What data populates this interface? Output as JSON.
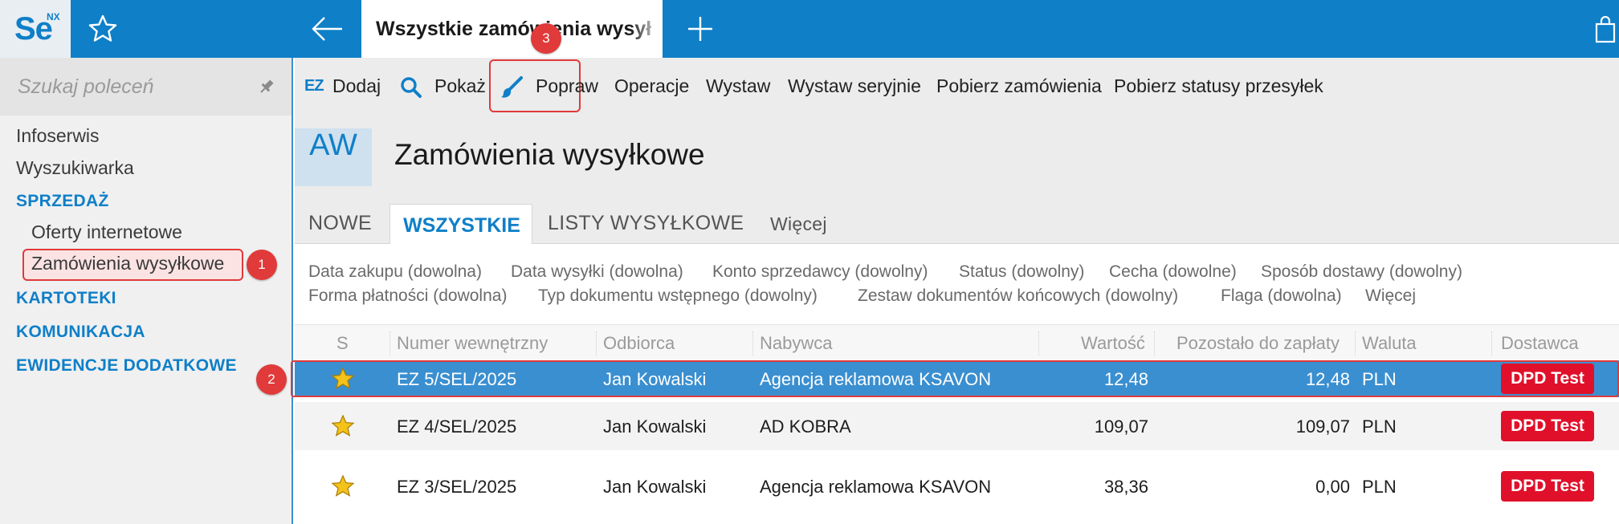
{
  "app": {
    "logo": "Se",
    "logo_sup": "NX",
    "active_tab": "Wszystkie zamówienia wysyłkowe"
  },
  "sidebar": {
    "search_placeholder": "Szukaj poleceń",
    "items": [
      {
        "label": "Infoserwis",
        "kind": "item"
      },
      {
        "label": "Wyszukiwarka",
        "kind": "item"
      },
      {
        "label": "SPRZEDAŻ",
        "kind": "section"
      },
      {
        "label": "Oferty internetowe",
        "kind": "subitem"
      },
      {
        "label": "Zamówienia wysyłkowe",
        "kind": "subitem",
        "active": true
      },
      {
        "label": "KARTOTEKI",
        "kind": "section"
      },
      {
        "label": "KOMUNIKACJA",
        "kind": "section"
      },
      {
        "label": "EWIDENCJE DODATKOWE",
        "kind": "section"
      }
    ]
  },
  "toolbar": {
    "ez": "EZ",
    "add": "Dodaj",
    "show": "Pokaż",
    "edit": "Popraw",
    "operations": "Operacje",
    "issue": "Wystaw",
    "issue_batch": "Wystaw seryjnie",
    "fetch_orders": "Pobierz zamówienia",
    "fetch_statuses": "Pobierz statusy przesyłek"
  },
  "page": {
    "code": "AW",
    "title": "Zamówienia wysyłkowe"
  },
  "tabs": {
    "new": "NOWE",
    "all": "WSZYSTKIE",
    "shipping_lists": "LISTY WYSYŁKOWE",
    "more": "Więcej"
  },
  "filters": [
    "Data zakupu (dowolna)",
    "Data wysyłki (dowolna)",
    "Konto sprzedawcy (dowolny)",
    "Status (dowolny)",
    "Cecha (dowolne)",
    "Sposób dostawy (dowolny)",
    "Forma płatności (dowolna)",
    "Typ dokumentu wstępnego (dowolny)",
    "Zestaw dokumentów końcowych (dowolny)",
    "Flaga (dowolna)",
    "Więcej"
  ],
  "table": {
    "columns": [
      "S",
      "Numer wewnętrzny",
      "Odbiorca",
      "Nabywca",
      "Wartość",
      "Pozostało do zapłaty",
      "Waluta",
      "Dostawca"
    ],
    "rows": [
      {
        "number": "EZ 5/SEL/2025",
        "recipient": "Jan Kowalski",
        "buyer": "Agencja reklamowa KSAVON",
        "value": "12,48",
        "remaining": "12,48",
        "currency": "PLN",
        "carrier": "DPD Test",
        "selected": true
      },
      {
        "number": "EZ 4/SEL/2025",
        "recipient": "Jan Kowalski",
        "buyer": "AD KOBRA",
        "value": "109,07",
        "remaining": "109,07",
        "currency": "PLN",
        "carrier": "DPD Test"
      },
      {
        "number": "EZ 3/SEL/2025",
        "recipient": "Jan Kowalski",
        "buyer": "Agencja reklamowa KSAVON",
        "value": "38,36",
        "remaining": "0,00",
        "currency": "PLN",
        "carrier": "DPD Test"
      }
    ]
  },
  "markers": [
    "1",
    "2",
    "3"
  ],
  "colors": {
    "accent": "#0f7fc8",
    "selected_row": "#3a8fd0",
    "highlight": "#e03a3a",
    "badge": "#e0102a"
  }
}
